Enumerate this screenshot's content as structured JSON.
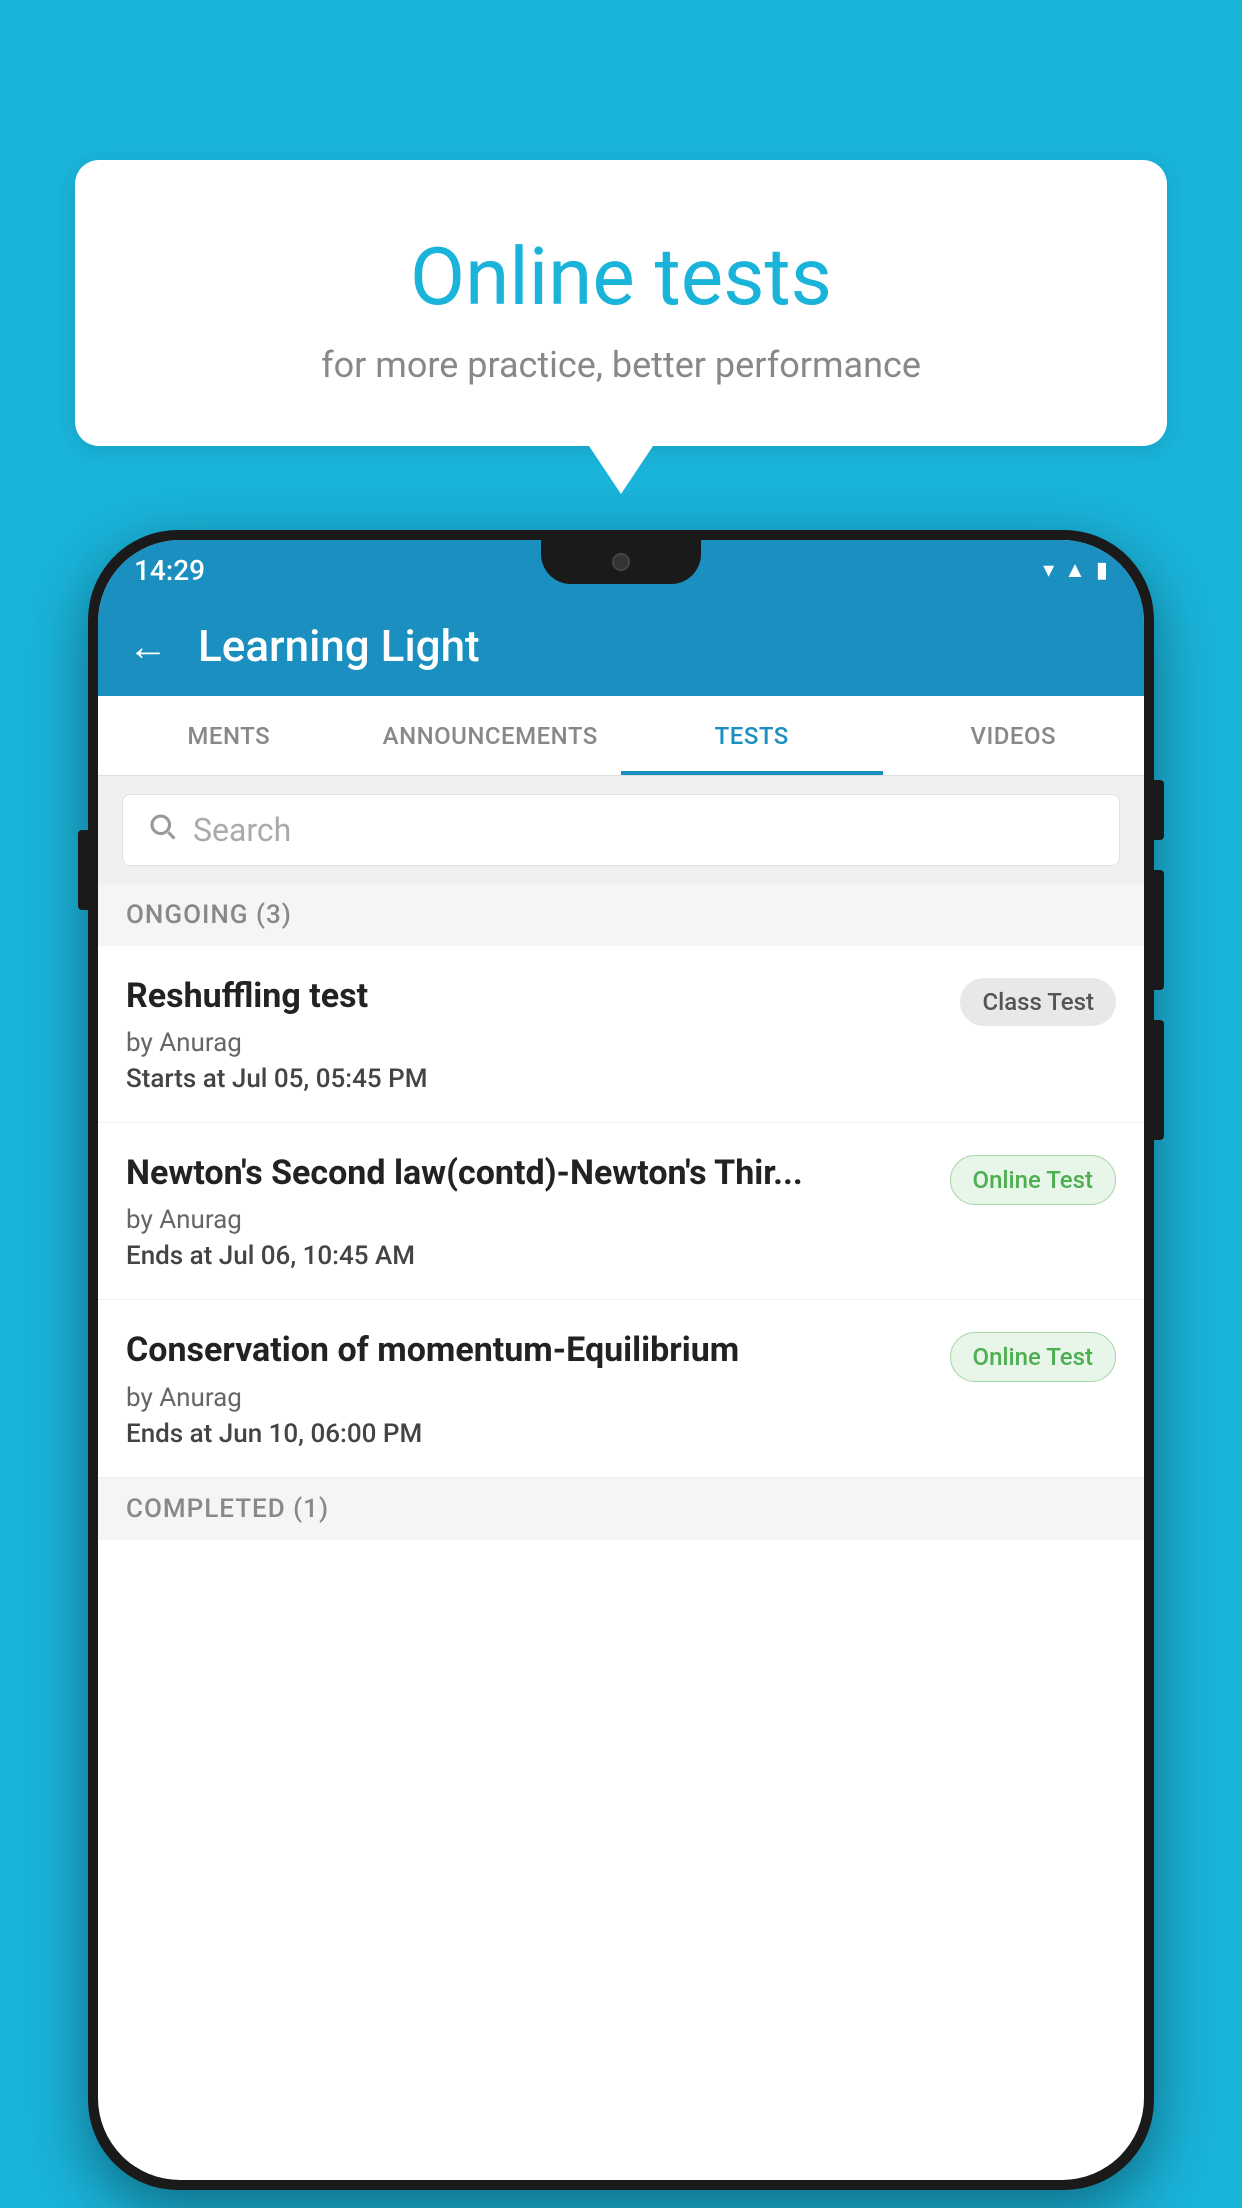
{
  "background": {
    "color": "#1ab3d9"
  },
  "speech_bubble": {
    "title": "Online tests",
    "subtitle": "for more practice, better performance"
  },
  "status_bar": {
    "time": "14:29",
    "icons": [
      "wifi",
      "signal",
      "battery"
    ]
  },
  "app_bar": {
    "back_label": "←",
    "title": "Learning Light"
  },
  "tabs": [
    {
      "label": "MENTS",
      "active": false
    },
    {
      "label": "ANNOUNCEMENTS",
      "active": false
    },
    {
      "label": "TESTS",
      "active": true
    },
    {
      "label": "VIDEOS",
      "active": false
    }
  ],
  "search": {
    "placeholder": "Search"
  },
  "ongoing_section": {
    "label": "ONGOING (3)",
    "tests": [
      {
        "name": "Reshuffling test",
        "author": "by Anurag",
        "date_label": "Starts at",
        "date_value": "Jul 05, 05:45 PM",
        "badge": "Class Test",
        "badge_type": "class"
      },
      {
        "name": "Newton's Second law(contd)-Newton's Thir...",
        "author": "by Anurag",
        "date_label": "Ends at",
        "date_value": "Jul 06, 10:45 AM",
        "badge": "Online Test",
        "badge_type": "online"
      },
      {
        "name": "Conservation of momentum-Equilibrium",
        "author": "by Anurag",
        "date_label": "Ends at",
        "date_value": "Jun 10, 06:00 PM",
        "badge": "Online Test",
        "badge_type": "online"
      }
    ]
  },
  "completed_section": {
    "label": "COMPLETED (1)"
  }
}
